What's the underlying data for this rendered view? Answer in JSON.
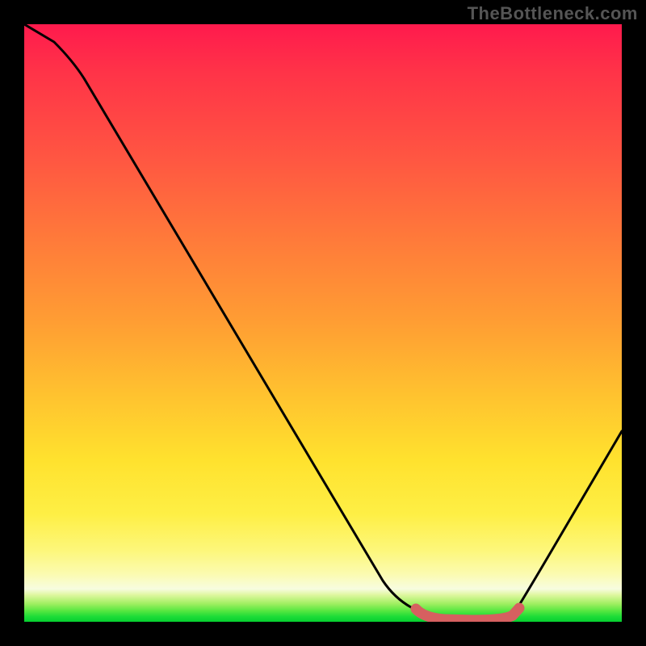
{
  "watermark": "TheBottleneck.com",
  "chart_data": {
    "type": "line",
    "title": "",
    "xlabel": "",
    "ylabel": "",
    "xlim": [
      0,
      100
    ],
    "ylim": [
      0,
      100
    ],
    "x": [
      0,
      5,
      10,
      15,
      20,
      25,
      30,
      35,
      40,
      45,
      50,
      55,
      60,
      65,
      70,
      75,
      80,
      82,
      85,
      90,
      95,
      100
    ],
    "values": [
      100,
      97,
      91,
      83,
      75,
      67,
      59,
      51,
      43,
      35,
      27,
      19,
      12,
      6,
      2,
      0,
      0,
      1,
      5,
      14,
      26,
      40
    ],
    "valley_band": {
      "x_start": 70,
      "x_end": 82,
      "y": 0.5
    },
    "background": "rainbow-gradient-red-to-green"
  }
}
